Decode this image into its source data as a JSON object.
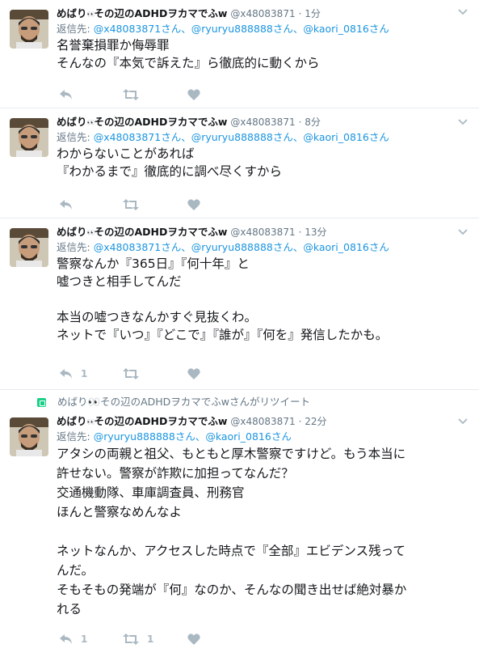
{
  "tweets": [
    {
      "author_name": "めばり",
      "author_name_rest": "その辺のADHDヲカマでふw",
      "eyes": "👀",
      "screen_name": "@x48083871",
      "time": "· 1分",
      "reply_prefix": "返信先: ",
      "reply_targets": "@x48083871さん、@ryuryu888888さん、@kaori_0816さん",
      "text": "名誉棄損罪か侮辱罪\nそんなの『本気で訴えた』ら徹底的に動くから",
      "reply_count": "",
      "retweet_count": "",
      "like_count": ""
    },
    {
      "author_name": "めばり",
      "author_name_rest": "その辺のADHDヲカマでふw",
      "eyes": "👀",
      "screen_name": "@x48083871",
      "time": "· 8分",
      "reply_prefix": "返信先: ",
      "reply_targets": "@x48083871さん、@ryuryu888888さん、@kaori_0816さん",
      "text": "わからないことがあれば\n『わかるまで』徹底的に調べ尽くすから",
      "reply_count": "",
      "retweet_count": "",
      "like_count": ""
    },
    {
      "author_name": "めばり",
      "author_name_rest": "その辺のADHDヲカマでふw",
      "eyes": "👀",
      "screen_name": "@x48083871",
      "time": "· 13分",
      "reply_prefix": "返信先: ",
      "reply_targets": "@x48083871さん、@ryuryu888888さん、@kaori_0816さん",
      "text": "警察なんか『365日』『何十年』と\n嘘つきと相手してんだ\n\n本当の嘘つきなんかすぐ見抜くわ。\nネットで『いつ』『どこで』『誰が』『何を』発信したかも。",
      "reply_count": "1",
      "retweet_count": "",
      "like_count": ""
    },
    {
      "retweet_context": "めばり👀その辺のADHDヲカマでふwさんがリツイート",
      "author_name": "めばり",
      "author_name_rest": "その辺のADHDヲカマでふw",
      "eyes": "👀",
      "screen_name": "@x48083871",
      "time": "· 22分",
      "reply_prefix": "返信先: ",
      "reply_targets": "@ryuryu888888さん、@kaori_0816さん",
      "text": "アタシの両親と祖父、もともと厚木警察ですけど。もう本当に\n許せない。警察が詐欺に加担ってなんだ？\n交通機動隊、車庫調査員、刑務官\nほんと警察なめんなよ\n\nネットなんか、アクセスした時点で『全部』エビデンス残って\nんだ。\nそもそもの発端が『何』なのか、そんなの聞き出せば絶対暴か\nれる",
      "reply_count": "1",
      "retweet_count": "1",
      "like_count": ""
    }
  ],
  "icons": {
    "reply": "reply-icon",
    "retweet": "retweet-icon",
    "like": "heart-icon",
    "caret": "chevron-down-icon"
  },
  "colors": {
    "link": "#1b95e0",
    "muted": "#657786",
    "icon": "#aab8c2",
    "retweet_badge": "#19cf86"
  }
}
